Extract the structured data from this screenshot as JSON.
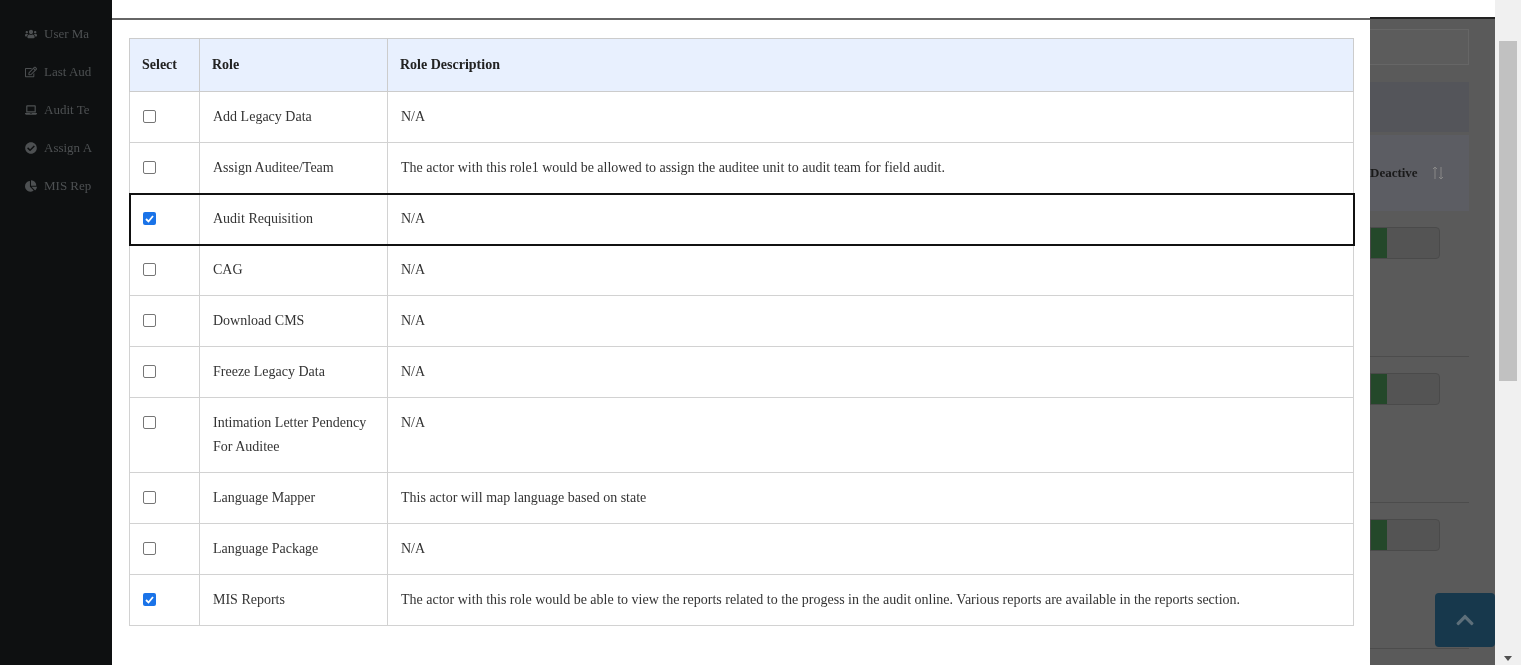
{
  "sidebar": {
    "items": [
      {
        "label": "User Ma"
      },
      {
        "label": "Last Aud"
      },
      {
        "label": "Audit Te"
      },
      {
        "label": "Assign A"
      },
      {
        "label": "MIS Rep"
      }
    ]
  },
  "modal": {
    "table": {
      "columns": [
        "Select",
        "Role",
        "Role Description"
      ],
      "rows": [
        {
          "checked": false,
          "highlighted": false,
          "role": "Add Legacy Data",
          "description": "N/A"
        },
        {
          "checked": false,
          "highlighted": false,
          "role": "Assign Auditee/Team",
          "description": "The actor with this role1 would be allowed to assign the auditee unit to audit team for field audit."
        },
        {
          "checked": true,
          "highlighted": true,
          "role": "Audit Requisition",
          "description": "N/A"
        },
        {
          "checked": false,
          "highlighted": false,
          "role": "CAG",
          "description": "N/A"
        },
        {
          "checked": false,
          "highlighted": false,
          "role": "Download CMS",
          "description": "N/A"
        },
        {
          "checked": false,
          "highlighted": false,
          "role": "Freeze Legacy Data",
          "description": "N/A"
        },
        {
          "checked": false,
          "highlighted": false,
          "role": "Intimation Letter Pendency For Auditee",
          "description": "N/A"
        },
        {
          "checked": false,
          "highlighted": false,
          "role": "Language Mapper",
          "description": "This actor will map language based on state"
        },
        {
          "checked": false,
          "highlighted": false,
          "role": "Language Package",
          "description": "N/A"
        },
        {
          "checked": true,
          "highlighted": false,
          "role": "MIS Reports",
          "description": "The actor with this role would be able to view the reports related to the progess in the audit online. Various reports are available in the reports section."
        }
      ]
    }
  },
  "background_table": {
    "column": "Deactive",
    "rows": [
      {
        "on": true
      },
      {
        "on": true
      },
      {
        "on": true
      }
    ]
  }
}
